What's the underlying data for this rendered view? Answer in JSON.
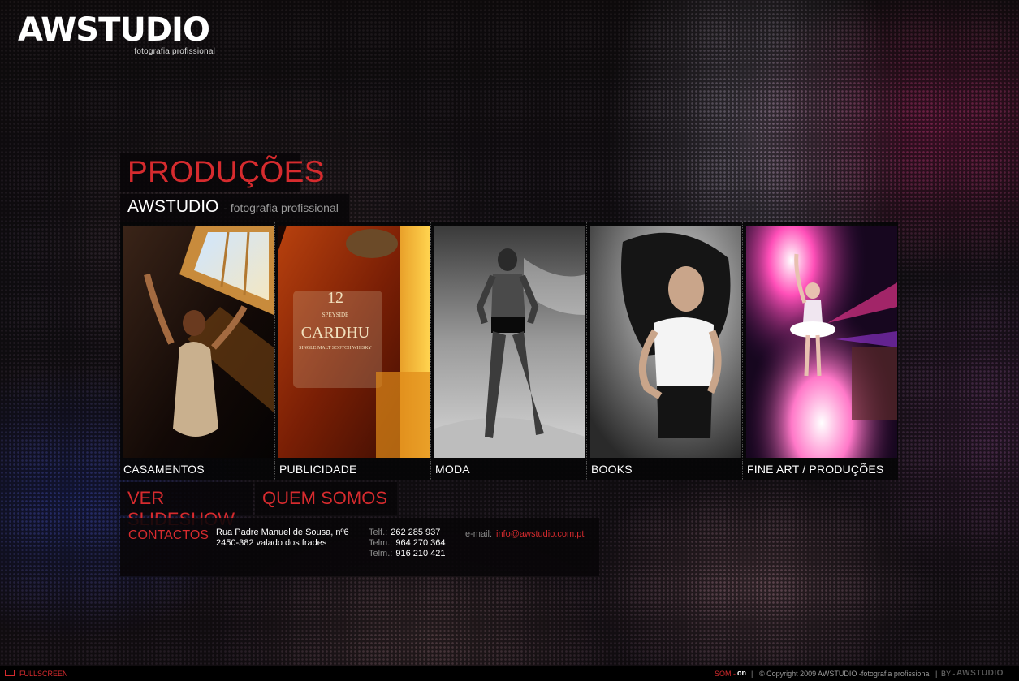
{
  "brand": {
    "logo_text": "AWSTUDIO",
    "tagline": "fotografia profissional"
  },
  "page": {
    "title": "PRODUÇÕES",
    "brand_name": "AWSTUDIO",
    "brand_tagline": "- fotografia profissional"
  },
  "categories": [
    {
      "label": "CASAMENTOS",
      "image": "wedding-photo"
    },
    {
      "label": "PUBLICIDADE",
      "image": "whisky-bottle-photo"
    },
    {
      "label": "MODA",
      "image": "fashion-model-photo"
    },
    {
      "label": "BOOKS",
      "image": "portrait-photo"
    },
    {
      "label": "FINE ART / PRODUÇÕES",
      "image": "ballerina-art-photo"
    }
  ],
  "actions": {
    "slideshow": "VER SLIDESHOW",
    "about": "QUEM SOMOS"
  },
  "contacts": {
    "title": "CONTACTOS",
    "address_line1": "Rua Padre Manuel de Sousa,  nº6",
    "address_line2": "2450-382 valado dos frades",
    "phones": [
      {
        "label": "Telf.:",
        "value": "262  285 937"
      },
      {
        "label": "Telm.:",
        "value": "964 270 364"
      },
      {
        "label": "Telm.:",
        "value": "916 210 421"
      }
    ],
    "email_label": "e-mail:",
    "email": "info@awstudio.com.pt"
  },
  "footer": {
    "fullscreen": "FULLSCREEN",
    "sound_label": "SOM -",
    "sound_state": "on",
    "separator": "|",
    "copyright": "© Copyright 2009 AWSTUDIO -fotografia profissional",
    "by_label": "BY -",
    "by_logo": "AWSTUDIO"
  },
  "colors": {
    "accent": "#d62b2e",
    "panel": "#080608",
    "text": "#ffffff"
  }
}
